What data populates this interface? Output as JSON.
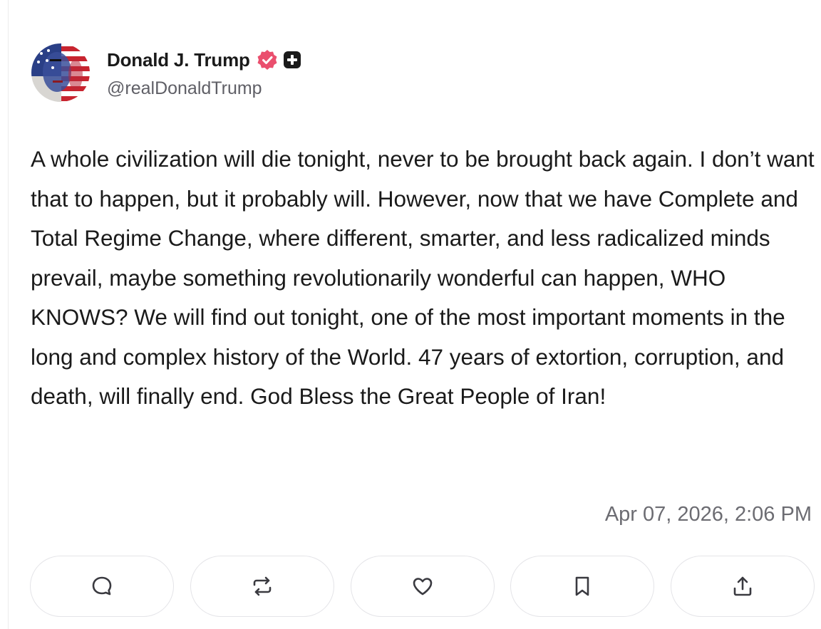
{
  "post": {
    "author": {
      "name": "Donald J. Trump",
      "handle": "@realDonaldTrump",
      "verified_badge_color": "#ea4f6e",
      "plus_badge_color": "#1a1a1a"
    },
    "text": "A whole civilization will die tonight, never to be brought back again. I don’t want that to happen, but it probably will. However, now that we have Complete and Total Regime Change, where different, smarter, and less radicalized minds prevail, maybe something revolutionarily wonderful can happen, WHO KNOWS? We will find out tonight, one of the most important moments in the long and complex history of the World. 47 years of extortion, corruption, and death, will finally end. God Bless the Great People of Iran!",
    "timestamp": "Apr 07, 2026, 2:06 PM"
  },
  "actions": [
    {
      "name": "reply",
      "icon": "comment-icon"
    },
    {
      "name": "repost",
      "icon": "repost-icon"
    },
    {
      "name": "like",
      "icon": "heart-icon"
    },
    {
      "name": "bookmark",
      "icon": "bookmark-icon"
    },
    {
      "name": "share",
      "icon": "share-icon"
    }
  ]
}
